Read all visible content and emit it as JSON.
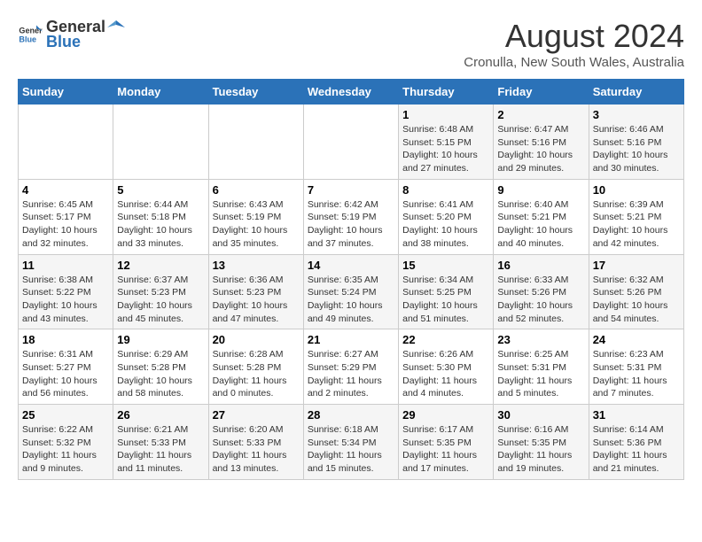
{
  "header": {
    "logo_general": "General",
    "logo_blue": "Blue",
    "title": "August 2024",
    "subtitle": "Cronulla, New South Wales, Australia"
  },
  "weekdays": [
    "Sunday",
    "Monday",
    "Tuesday",
    "Wednesday",
    "Thursday",
    "Friday",
    "Saturday"
  ],
  "weeks": [
    [
      {
        "day": "",
        "content": ""
      },
      {
        "day": "",
        "content": ""
      },
      {
        "day": "",
        "content": ""
      },
      {
        "day": "",
        "content": ""
      },
      {
        "day": "1",
        "content": "Sunrise: 6:48 AM\nSunset: 5:15 PM\nDaylight: 10 hours and 27 minutes."
      },
      {
        "day": "2",
        "content": "Sunrise: 6:47 AM\nSunset: 5:16 PM\nDaylight: 10 hours and 29 minutes."
      },
      {
        "day": "3",
        "content": "Sunrise: 6:46 AM\nSunset: 5:16 PM\nDaylight: 10 hours and 30 minutes."
      }
    ],
    [
      {
        "day": "4",
        "content": "Sunrise: 6:45 AM\nSunset: 5:17 PM\nDaylight: 10 hours and 32 minutes."
      },
      {
        "day": "5",
        "content": "Sunrise: 6:44 AM\nSunset: 5:18 PM\nDaylight: 10 hours and 33 minutes."
      },
      {
        "day": "6",
        "content": "Sunrise: 6:43 AM\nSunset: 5:19 PM\nDaylight: 10 hours and 35 minutes."
      },
      {
        "day": "7",
        "content": "Sunrise: 6:42 AM\nSunset: 5:19 PM\nDaylight: 10 hours and 37 minutes."
      },
      {
        "day": "8",
        "content": "Sunrise: 6:41 AM\nSunset: 5:20 PM\nDaylight: 10 hours and 38 minutes."
      },
      {
        "day": "9",
        "content": "Sunrise: 6:40 AM\nSunset: 5:21 PM\nDaylight: 10 hours and 40 minutes."
      },
      {
        "day": "10",
        "content": "Sunrise: 6:39 AM\nSunset: 5:21 PM\nDaylight: 10 hours and 42 minutes."
      }
    ],
    [
      {
        "day": "11",
        "content": "Sunrise: 6:38 AM\nSunset: 5:22 PM\nDaylight: 10 hours and 43 minutes."
      },
      {
        "day": "12",
        "content": "Sunrise: 6:37 AM\nSunset: 5:23 PM\nDaylight: 10 hours and 45 minutes."
      },
      {
        "day": "13",
        "content": "Sunrise: 6:36 AM\nSunset: 5:23 PM\nDaylight: 10 hours and 47 minutes."
      },
      {
        "day": "14",
        "content": "Sunrise: 6:35 AM\nSunset: 5:24 PM\nDaylight: 10 hours and 49 minutes."
      },
      {
        "day": "15",
        "content": "Sunrise: 6:34 AM\nSunset: 5:25 PM\nDaylight: 10 hours and 51 minutes."
      },
      {
        "day": "16",
        "content": "Sunrise: 6:33 AM\nSunset: 5:26 PM\nDaylight: 10 hours and 52 minutes."
      },
      {
        "day": "17",
        "content": "Sunrise: 6:32 AM\nSunset: 5:26 PM\nDaylight: 10 hours and 54 minutes."
      }
    ],
    [
      {
        "day": "18",
        "content": "Sunrise: 6:31 AM\nSunset: 5:27 PM\nDaylight: 10 hours and 56 minutes."
      },
      {
        "day": "19",
        "content": "Sunrise: 6:29 AM\nSunset: 5:28 PM\nDaylight: 10 hours and 58 minutes."
      },
      {
        "day": "20",
        "content": "Sunrise: 6:28 AM\nSunset: 5:28 PM\nDaylight: 11 hours and 0 minutes."
      },
      {
        "day": "21",
        "content": "Sunrise: 6:27 AM\nSunset: 5:29 PM\nDaylight: 11 hours and 2 minutes."
      },
      {
        "day": "22",
        "content": "Sunrise: 6:26 AM\nSunset: 5:30 PM\nDaylight: 11 hours and 4 minutes."
      },
      {
        "day": "23",
        "content": "Sunrise: 6:25 AM\nSunset: 5:31 PM\nDaylight: 11 hours and 5 minutes."
      },
      {
        "day": "24",
        "content": "Sunrise: 6:23 AM\nSunset: 5:31 PM\nDaylight: 11 hours and 7 minutes."
      }
    ],
    [
      {
        "day": "25",
        "content": "Sunrise: 6:22 AM\nSunset: 5:32 PM\nDaylight: 11 hours and 9 minutes."
      },
      {
        "day": "26",
        "content": "Sunrise: 6:21 AM\nSunset: 5:33 PM\nDaylight: 11 hours and 11 minutes."
      },
      {
        "day": "27",
        "content": "Sunrise: 6:20 AM\nSunset: 5:33 PM\nDaylight: 11 hours and 13 minutes."
      },
      {
        "day": "28",
        "content": "Sunrise: 6:18 AM\nSunset: 5:34 PM\nDaylight: 11 hours and 15 minutes."
      },
      {
        "day": "29",
        "content": "Sunrise: 6:17 AM\nSunset: 5:35 PM\nDaylight: 11 hours and 17 minutes."
      },
      {
        "day": "30",
        "content": "Sunrise: 6:16 AM\nSunset: 5:35 PM\nDaylight: 11 hours and 19 minutes."
      },
      {
        "day": "31",
        "content": "Sunrise: 6:14 AM\nSunset: 5:36 PM\nDaylight: 11 hours and 21 minutes."
      }
    ]
  ]
}
